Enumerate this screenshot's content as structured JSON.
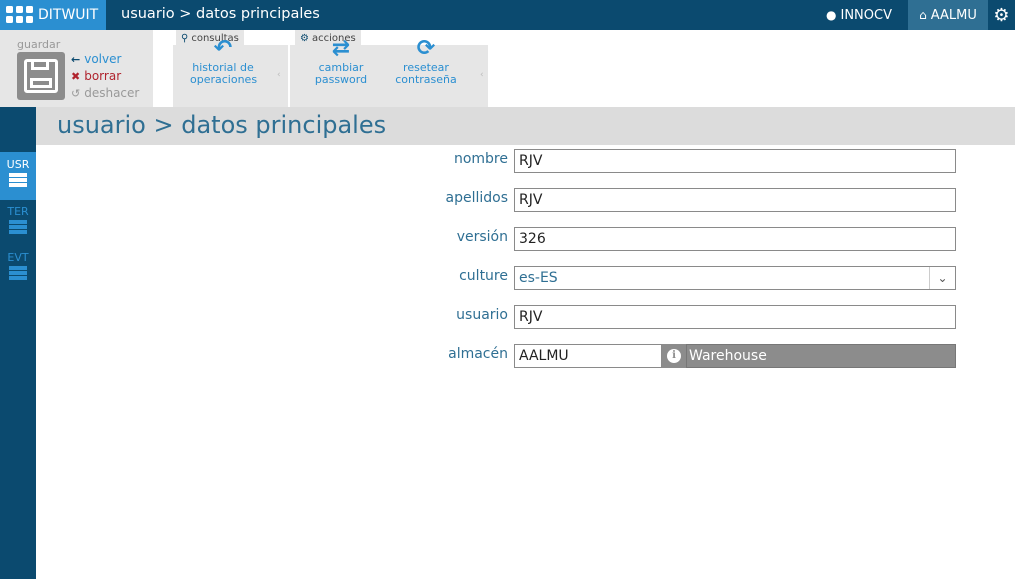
{
  "header": {
    "brand": "DITWUIT",
    "breadcrumb": "usuario > datos principales",
    "user": "INNOCV",
    "store": "AALMU"
  },
  "toolbar": {
    "save_group_title": "guardar",
    "links": {
      "volver": "volver",
      "borrar": "borrar",
      "deshacer": "deshacer"
    },
    "consultas_label": "consultas",
    "acciones_label": "acciones",
    "historial_line1": "historial de",
    "historial_line2": "operaciones",
    "cambiar_line1": "cambiar",
    "cambiar_line2": "password",
    "resetear_line1": "resetear",
    "resetear_line2": "contraseña"
  },
  "sidebar": {
    "items": [
      {
        "label": "USR",
        "active": true
      },
      {
        "label": "TER",
        "active": false
      },
      {
        "label": "EVT",
        "active": false
      }
    ]
  },
  "page": {
    "title": "usuario > datos principales"
  },
  "form": {
    "nombre": {
      "label": "nombre",
      "value": "RJV"
    },
    "apellidos": {
      "label": "apellidos",
      "value": "RJV"
    },
    "version": {
      "label": "versión",
      "value": "326"
    },
    "culture": {
      "label": "culture",
      "value": "es-ES"
    },
    "usuario": {
      "label": "usuario",
      "value": "RJV"
    },
    "almacen": {
      "label": "almacén",
      "code": "AALMU",
      "name": "Warehouse"
    }
  },
  "colors": {
    "topbar": "#0b4a6f",
    "accent": "#2b8fd1",
    "label": "#2f6f93",
    "danger": "#b0242e"
  }
}
